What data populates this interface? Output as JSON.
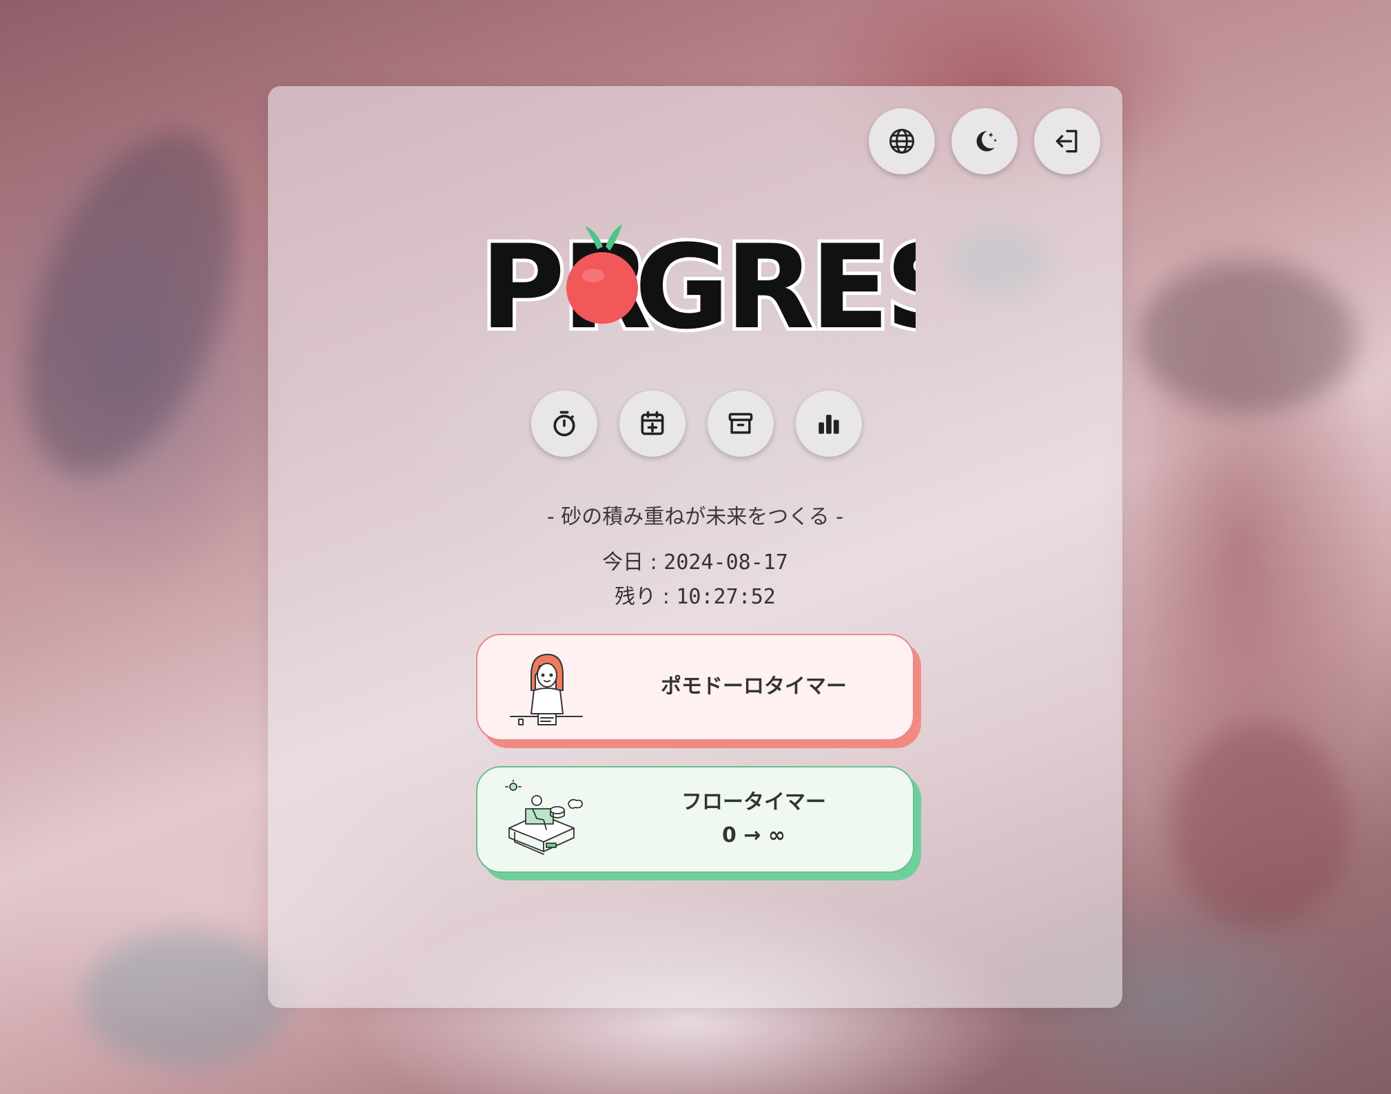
{
  "app": {
    "logo_text": "PROGRESS"
  },
  "header_buttons": [
    {
      "name": "language",
      "icon": "globe-icon"
    },
    {
      "name": "theme",
      "icon": "moon-stars-icon"
    },
    {
      "name": "logout",
      "icon": "logout-icon"
    }
  ],
  "nav_buttons": [
    {
      "name": "timer",
      "icon": "stopwatch-icon"
    },
    {
      "name": "calendar",
      "icon": "calendar-plus-icon"
    },
    {
      "name": "archive",
      "icon": "archive-icon"
    },
    {
      "name": "stats",
      "icon": "bar-chart-icon"
    }
  ],
  "motto": "- 砂の積み重ねが未来をつくる -",
  "today": {
    "label": "今日 : ",
    "value": "2024-08-17"
  },
  "remaining": {
    "label": "残り : ",
    "value": "10:27:52"
  },
  "cards": {
    "pomodoro": {
      "label": "ポモドーロタイマー",
      "accent": "#f28a84",
      "bg": "#fff1f1",
      "border": "#e58b86"
    },
    "flow": {
      "label": "フロータイマー",
      "sub": "0 → ∞",
      "accent": "#6fcf9a",
      "bg": "#eff8f1",
      "border": "#6bbf8e"
    }
  },
  "colors": {
    "tomato": "#f2575a",
    "leaf": "#4fc38a"
  }
}
